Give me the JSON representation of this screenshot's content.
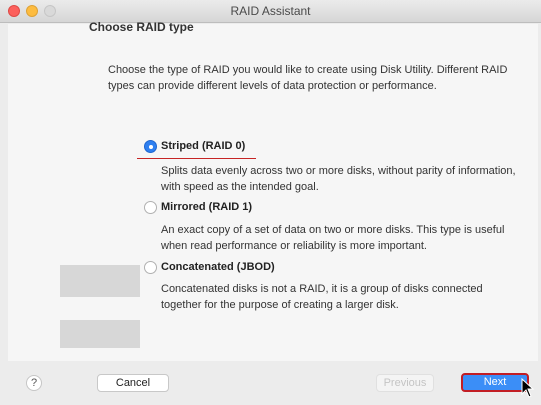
{
  "window": {
    "title": "RAID Assistant"
  },
  "section": {
    "heading": "Choose RAID type"
  },
  "intro": "Choose the type of RAID you would like to create using Disk Utility. Different RAID types can provide different levels of data protection or performance.",
  "options": [
    {
      "label": "Striped (RAID 0)",
      "description": "Splits data evenly across two or more disks, without parity of information, with speed as the intended goal.",
      "selected": true
    },
    {
      "label": "Mirrored (RAID 1)",
      "description": "An exact copy of a set of data on two or more disks. This type is useful when read performance or reliability is more important.",
      "selected": false
    },
    {
      "label": "Concatenated (JBOD)",
      "description": "Concatenated disks is not a RAID, it is a group of disks connected together for the purpose of creating a larger disk.",
      "selected": false
    }
  ],
  "buttons": {
    "help": "?",
    "cancel": "Cancel",
    "previous": "Previous",
    "next": "Next"
  },
  "colors": {
    "accent": "#2e7ff0",
    "highlight": "#c21d24"
  }
}
